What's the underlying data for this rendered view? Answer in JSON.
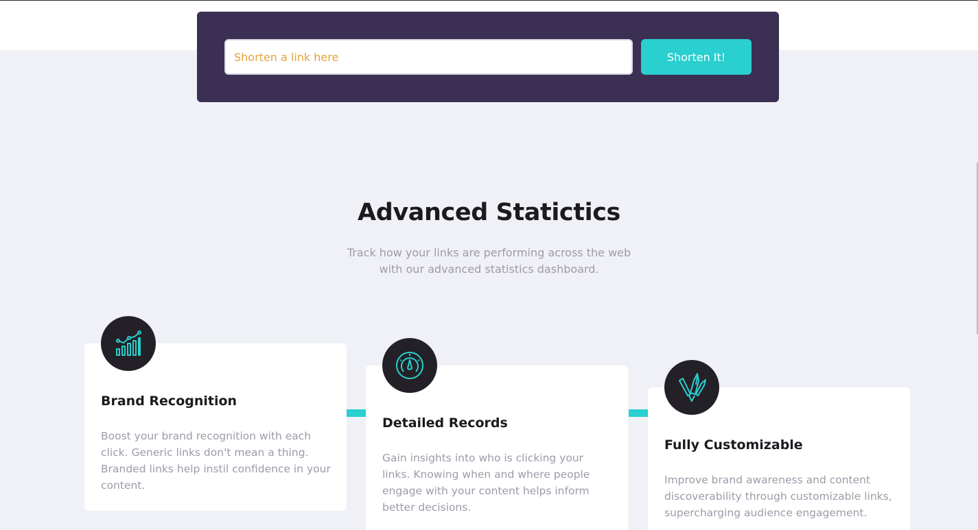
{
  "shortener": {
    "input_placeholder": "Shorten a link here",
    "button_label": "Shorten It!"
  },
  "statistics": {
    "title": "Advanced Statictics",
    "subtitle": "Track how your links are performing across the web with our advanced statistics dashboard."
  },
  "cards": [
    {
      "icon": "bar-chart-icon",
      "title": "Brand Recognition",
      "text": "Boost your brand recognition with each click. Generic links don't mean a thing. Branded links help instil confidence in your content."
    },
    {
      "icon": "gauge-icon",
      "title": "Detailed Records",
      "text": "Gain insights into who is clicking your links. Knowing when and where people engage with your content helps inform better decisions."
    },
    {
      "icon": "brush-pen-icon",
      "title": "Fully Customizable",
      "text": "Improve brand awareness and content discoverability through customizable links, supercharging audience engagement."
    }
  ],
  "colors": {
    "accent": "#2acfcf",
    "dark_violet": "#3b3054",
    "placeholder": "#e2a33a",
    "icon_bg": "#232127",
    "body_text": "#9e9aa8",
    "page_bg": "#f0f1f6"
  }
}
